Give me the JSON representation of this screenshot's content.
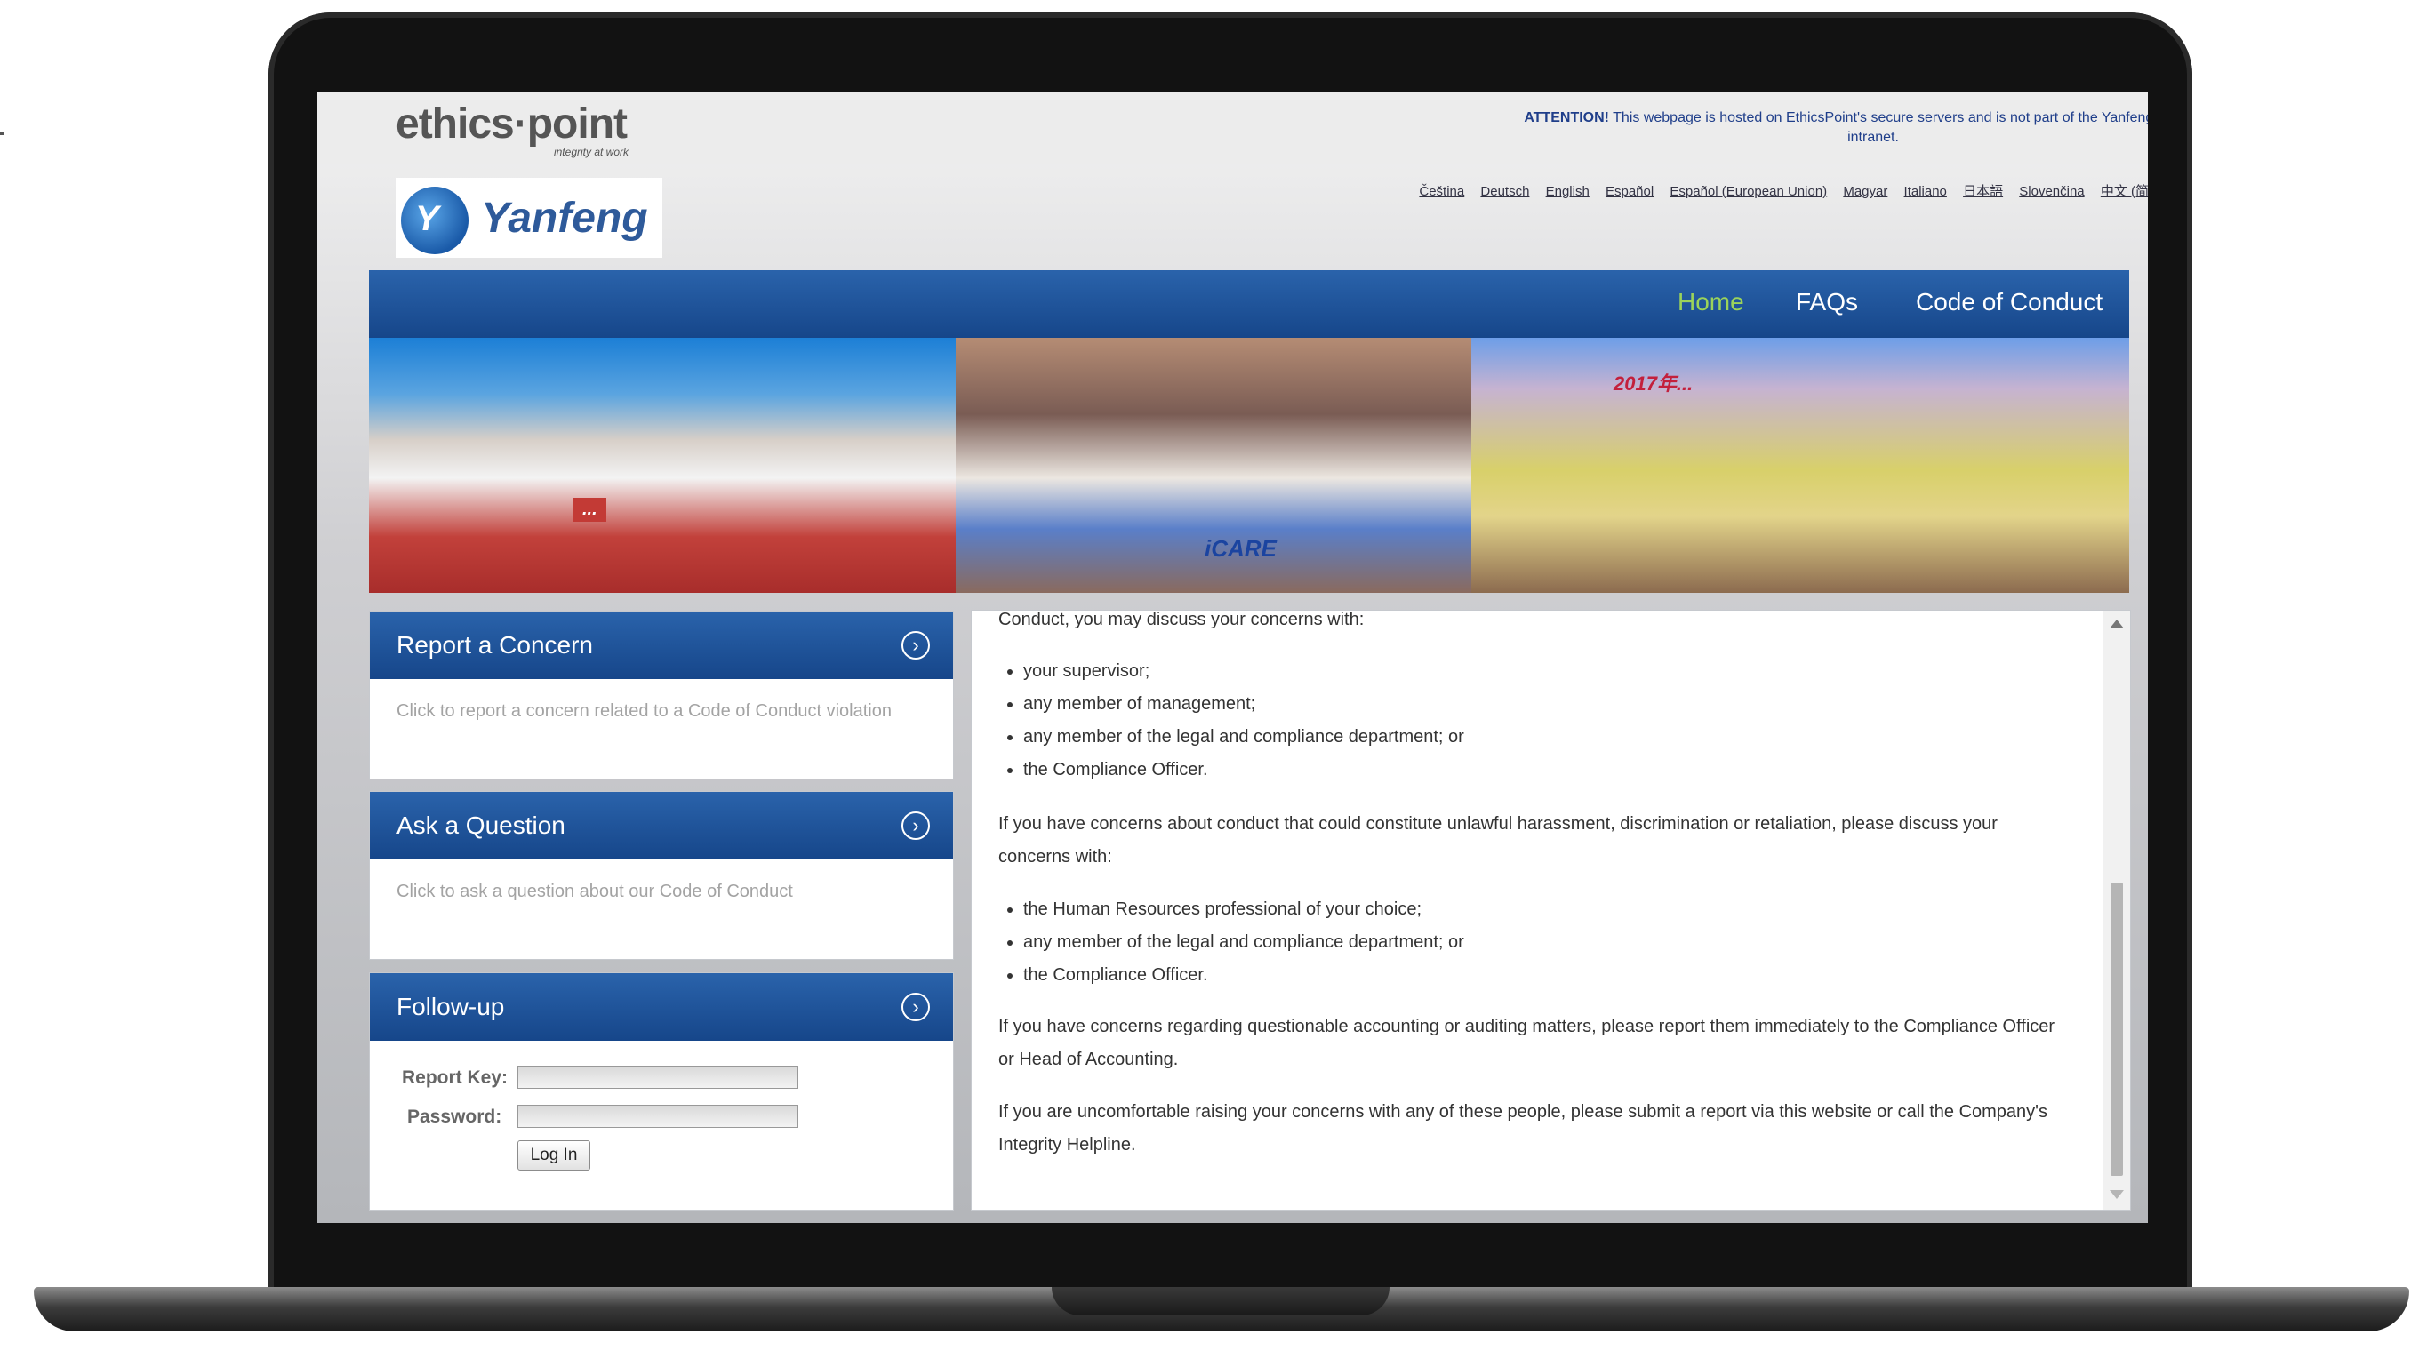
{
  "topbar": {
    "logo_word": "ethics·point",
    "logo_tagline": "integrity at work",
    "attention_strong": "ATTENTION!",
    "attention_text": "This webpage is hosted on EthicsPoint's secure servers and is not part of the Yanfeng website or intranet."
  },
  "brand": {
    "mark": "Y",
    "name": "Yanfeng"
  },
  "languages": [
    "Čeština",
    "Deutsch",
    "English",
    "Español",
    "Español (European Union)",
    "Magyar",
    "Italiano",
    "日本語",
    "Slovenčina",
    "中文 (简体)"
  ],
  "nav": {
    "home": "Home",
    "faqs": "FAQs",
    "code_of_conduct": "Code of Conduct"
  },
  "banner": {
    "photo1_caption": "...",
    "photo2_caption": "iCARE",
    "photo3_caption": "2017年..."
  },
  "panels": {
    "report": {
      "title": "Report a Concern",
      "desc": "Click to report a concern related to a Code of Conduct violation"
    },
    "ask": {
      "title": "Ask a Question",
      "desc": "Click to ask a question about our Code of Conduct"
    },
    "followup": {
      "title": "Follow-up",
      "report_key_label": "Report Key:",
      "password_label": "Password:",
      "login_button": "Log In"
    }
  },
  "content": {
    "intro": "Conduct, you may discuss your concerns with:",
    "list1": [
      "your supervisor;",
      "any member of management;",
      "any member of the legal and compliance department; or",
      "the Compliance Officer."
    ],
    "para2": "If you have concerns about conduct that could constitute unlawful harassment, discrimination or retaliation, please discuss your concerns with:",
    "list2": [
      "the Human Resources professional of your choice;",
      "any member of the legal and compliance department; or",
      "the Compliance Officer."
    ],
    "para3": "If you have concerns regarding questionable accounting or auditing matters, please report them immediately to the Compliance Officer or Head of Accounting.",
    "para4": "If you are uncomfortable raising your concerns with any of these people, please submit a report via this website or call the Company's Integrity Helpline."
  },
  "colors": {
    "nav_blue": "#1f5aa0",
    "home_green": "#9bd35a",
    "attention_blue": "#1f3e8a"
  }
}
